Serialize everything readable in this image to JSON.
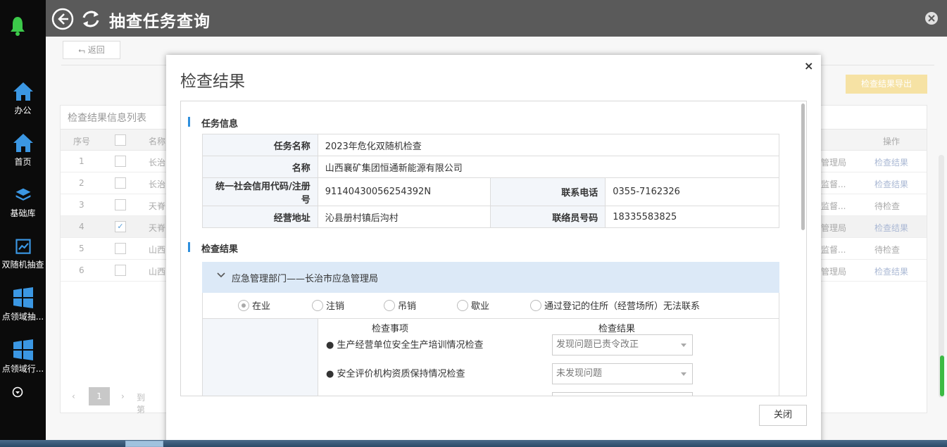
{
  "topbar": {
    "title": "抽查任务查询"
  },
  "sidebar": {
    "items": [
      {
        "label": "办公",
        "icon": "home-icon"
      },
      {
        "label": "首页",
        "icon": "home-icon"
      },
      {
        "label": "基础库",
        "icon": "layers-icon"
      },
      {
        "label": "双随机抽查",
        "icon": "chart-icon"
      },
      {
        "label": "点领域抽...",
        "icon": "windows-icon"
      },
      {
        "label": "点领域行...",
        "icon": "windows-icon"
      }
    ]
  },
  "page": {
    "return_label": "返回",
    "export_label": "检查结果导出",
    "list_title": "检查结果信息列表",
    "columns": {
      "no": "序号",
      "name": "名称",
      "op": "操作"
    },
    "rows": [
      {
        "no": "1",
        "name": "长治",
        "dept": "管理局",
        "op": "检查结果"
      },
      {
        "no": "2",
        "name": "长治",
        "dept": "监督...",
        "op": "检查结果"
      },
      {
        "no": "3",
        "name": "天脊",
        "dept": "监督...",
        "op": "待检查"
      },
      {
        "no": "4",
        "name": "天脊",
        "dept": "管理局",
        "op": "检查结果"
      },
      {
        "no": "5",
        "name": "山西",
        "dept": "监督...",
        "op": "待检查"
      },
      {
        "no": "6",
        "name": "山西",
        "dept": "管理局",
        "op": "检查结果"
      }
    ],
    "pager": {
      "current": "1",
      "goto": "到第"
    }
  },
  "modal": {
    "title": "检查结果",
    "close_x": "×",
    "task_section": "任务信息",
    "task": {
      "task_name_label": "任务名称",
      "task_name": "2023年危化双随机检查",
      "name_label": "名称",
      "name": "山西襄矿集团恒通新能源有限公司",
      "credit_label": "统一社会信用代码/注册号",
      "credit": "91140430056254392N",
      "phone_label": "联系电话",
      "phone": "0355-7162326",
      "address_label": "经营地址",
      "address": "沁县册村镇后沟村",
      "liaison_label": "联络员号码",
      "liaison": "18335583825"
    },
    "result_section": "检查结果",
    "dept_header": "应急管理部门——长治市应急管理局",
    "status_options": [
      "在业",
      "注销",
      "吊销",
      "歇业",
      "通过登记的住所（经营场所）无法联系"
    ],
    "status_selected": "在业",
    "check_items_header": "检查事项",
    "check_results_header": "检查结果",
    "check_items": [
      {
        "item": "生产经营单位安全生产培训情况检查",
        "result": "发现问题已责令改正"
      },
      {
        "item": "安全评价机构资质保持情况检查",
        "result": "未发现问题"
      }
    ],
    "close_button": "关闭"
  }
}
